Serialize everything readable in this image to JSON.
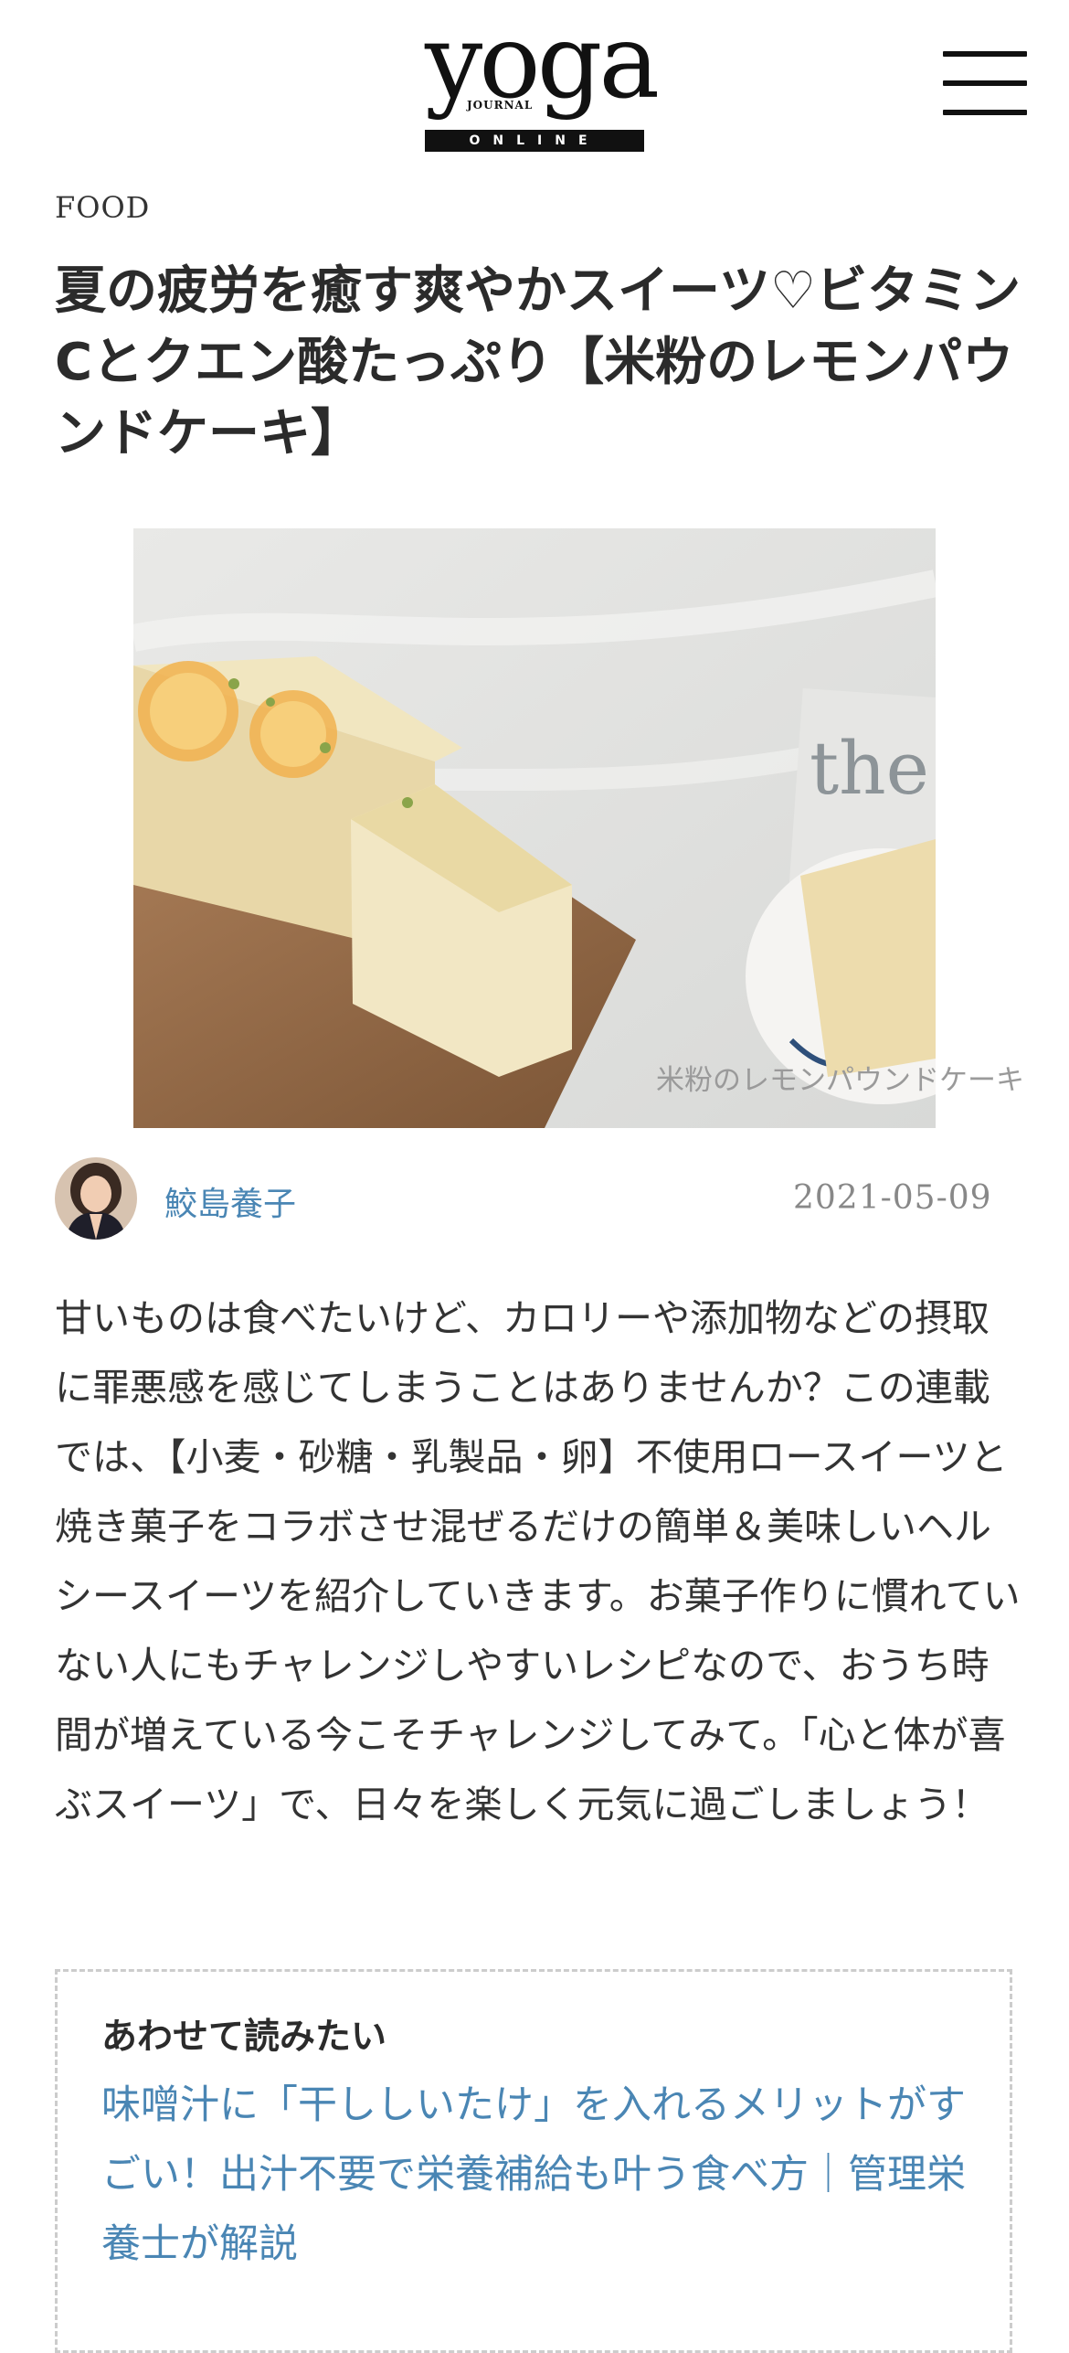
{
  "header": {
    "logo_main": "yoga",
    "logo_sub": "JOURNAL",
    "logo_bar": "ONLINE",
    "menu_icon": "hamburger-menu-icon"
  },
  "article": {
    "category": "FOOD",
    "title": "夏の疲労を癒す爽やかスイーツ♡ビタミンCとクエン酸たっぷり【米粉のレモンパウンドケーキ】",
    "image_caption": "米粉のレモンパウンドケーキ",
    "author": "鮫島養子",
    "date": "2021-05-09",
    "intro": "甘いものは食べたいけど、カロリーや添加物などの摂取に罪悪感を感じてしまうことはありませんか？この連載では、【小麦・砂糖・乳製品・卵】不使用ロースイーツと焼き菓子をコラボさせ混ぜるだけの簡単＆美味しいヘルシースイーツを紹介していきます。お菓子作りに慣れていない人にもチャレンジしやすいレシピなので、おうち時間が増えている今こそチャレンジしてみて。「心と体が喜ぶスイーツ」で、日々を楽しく元気に過ごしましょう！"
  },
  "related": {
    "heading": "あわせて読みたい",
    "link_text": "味噌汁に「干ししいたけ」を入れるメリットがすごい！出汁不要で栄養補給も叶う食べ方｜管理栄養士が解説"
  },
  "colors": {
    "link": "#4a86b4",
    "text": "#333333",
    "muted": "#888888"
  }
}
